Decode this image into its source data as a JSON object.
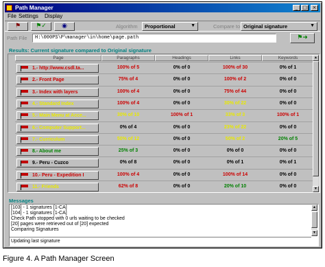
{
  "window": {
    "title": "Path Manager",
    "controls": {
      "minimize": "_",
      "maximize": "□",
      "close": "×"
    }
  },
  "menu": [
    "File",
    "Settings",
    "Display"
  ],
  "toolbar": {
    "algorithm_label": "Algorithm",
    "algorithm_value": "Proportional",
    "compare_label": "Compare to",
    "compare_value": "Original signature",
    "dropdown_glyph": "▼",
    "button_icons": [
      "flag-icon",
      "green-flag-icon",
      "eye-icon"
    ]
  },
  "path": {
    "label": "Path File",
    "value": "H:\\000PS\\P\\manager\\in\\home\\page.path",
    "go_icon": "go-icon"
  },
  "results": {
    "title": "Results: Current signature compared to Original signature",
    "columns": [
      "Page",
      "Paragraphs",
      "Headings",
      "Links",
      "Keywords"
    ],
    "rows": [
      {
        "page": "1.- http://www.csdl.ta...",
        "page_color": "#cc0000",
        "paragraphs": "100% of 5",
        "paragraphs_color": "#cc0000",
        "headings": "0% of 0",
        "headings_color": "#000000",
        "links": "100% of 30",
        "links_color": "#cc0000",
        "keywords": "0% of 1",
        "keywords_color": "#000000"
      },
      {
        "page": "2.- Front Page",
        "page_color": "#cc0000",
        "paragraphs": "75% of 4",
        "paragraphs_color": "#cc0000",
        "headings": "0% of 0",
        "headings_color": "#000000",
        "links": "100% of 2",
        "links_color": "#cc0000",
        "keywords": "0% of 0",
        "keywords_color": "#000000"
      },
      {
        "page": "3.- Index with layers",
        "page_color": "#cc0000",
        "paragraphs": "100% of 4",
        "paragraphs_color": "#cc0000",
        "headings": "0% of 0",
        "headings_color": "#000000",
        "links": "75% of 44",
        "links_color": "#cc0000",
        "keywords": "0% of 0",
        "keywords_color": "#000000"
      },
      {
        "page": "4.- Standard Index",
        "page_color": "#e8e800",
        "paragraphs": "100% of 4",
        "paragraphs_color": "#cc0000",
        "headings": "0% of 0",
        "headings_color": "#000000",
        "links": "30% of 22",
        "links_color": "#e8e800",
        "keywords": "0% of 0",
        "keywords_color": "#000000"
      },
      {
        "page": "5.- Main Menu at Acce...",
        "page_color": "#e8e800",
        "paragraphs": "30% of 10",
        "paragraphs_color": "#e8e800",
        "headings": "100% of 1",
        "headings_color": "#cc0000",
        "links": "33% of 3",
        "links_color": "#e8e800",
        "keywords": "100% of 1",
        "keywords_color": "#cc0000"
      },
      {
        "page": "6.- Computer Support...",
        "page_color": "#e8e800",
        "paragraphs": "0% of 4",
        "paragraphs_color": "#000000",
        "headings": "0% of 0",
        "headings_color": "#000000",
        "links": "23% of 22",
        "links_color": "#e8e800",
        "keywords": "0% of 0",
        "keywords_color": "#000000"
      },
      {
        "page": "7.- Curriculum",
        "page_color": "#e8e800",
        "paragraphs": "50% of 12",
        "paragraphs_color": "#e8e800",
        "headings": "0% of 0",
        "headings_color": "#000000",
        "links": "50% of 2",
        "links_color": "#e8e800",
        "keywords": "20% of 5",
        "keywords_color": "#008000"
      },
      {
        "page": "8.- About me",
        "page_color": "#008000",
        "paragraphs": "25% of 3",
        "paragraphs_color": "#008000",
        "headings": "0% of 0",
        "headings_color": "#000000",
        "links": "0% of 0",
        "links_color": "#000000",
        "keywords": "0% of 0",
        "keywords_color": "#000000"
      },
      {
        "page": "9.- Peru - Cuzco",
        "page_color": "#000000",
        "paragraphs": "0% of 8",
        "paragraphs_color": "#000000",
        "headings": "0% of 0",
        "headings_color": "#000000",
        "links": "0% of 1",
        "links_color": "#000000",
        "keywords": "0% of 1",
        "keywords_color": "#000000"
      },
      {
        "page": "10.- Peru - Expedition I",
        "page_color": "#cc0000",
        "paragraphs": "100% of 4",
        "paragraphs_color": "#cc0000",
        "headings": "0% of 0",
        "headings_color": "#000000",
        "links": "100% of 14",
        "links_color": "#cc0000",
        "keywords": "0% of 0",
        "keywords_color": "#000000"
      },
      {
        "page": "11.- Friends",
        "page_color": "#e8e800",
        "paragraphs": "62% of 8",
        "paragraphs_color": "#cc0000",
        "headings": "0% of 0",
        "headings_color": "#000000",
        "links": "20% of 10",
        "links_color": "#008000",
        "keywords": "0% of 0",
        "keywords_color": "#000000"
      }
    ]
  },
  "messages": {
    "title": "Messages",
    "lines": [
      "[103] - 1 signatures [1-CA]",
      "[104] - 1 signatures [1-CA]",
      "Check Path stopped with 0 urls waiting to be checked",
      "[20] pages were retrieved out of [20] expected",
      "Comparing Signatures"
    ],
    "status": "Updating last signature"
  },
  "caption": "Figure 4. A Path Manager Screen"
}
